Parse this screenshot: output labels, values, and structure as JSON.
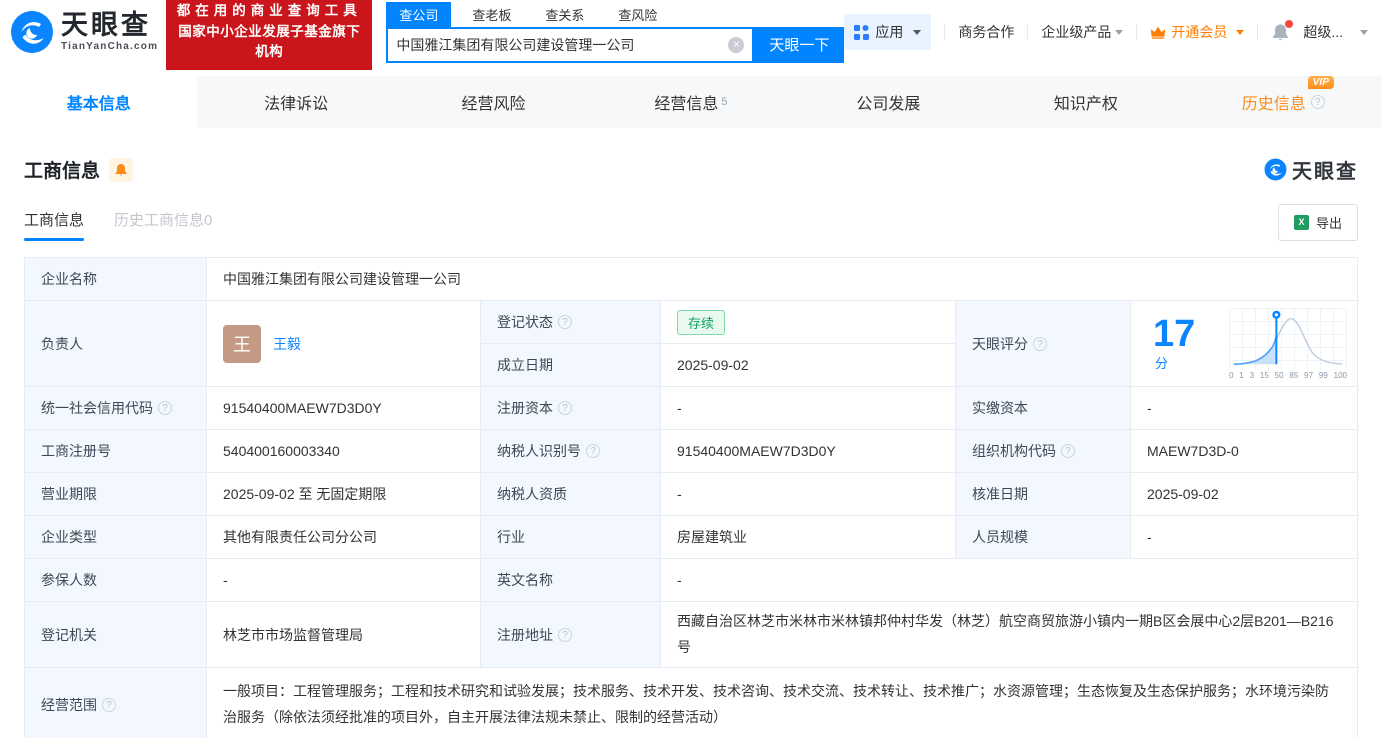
{
  "colors": {
    "brand_blue": "#0084ff",
    "orange": "#ff8c1a",
    "green_status": "#0ba360",
    "banner_red": "#c9151b"
  },
  "header": {
    "logo_title": "天眼查",
    "logo_domain": "TianYanCha.com",
    "banner_line1": "都在用的商业查询工具",
    "banner_line2": "国家中小企业发展子基金旗下机构",
    "search_tabs": [
      {
        "label": "查公司"
      },
      {
        "label": "查老板"
      },
      {
        "label": "查关系"
      },
      {
        "label": "查风险"
      }
    ],
    "search_value": "中国雅江集团有限公司建设管理一公司",
    "search_button": "天眼一下",
    "nav_apps": "应用",
    "nav_cooperation": "商务合作",
    "nav_enterprise": "企业级产品",
    "nav_vip": "开通会员",
    "nav_account": "超级..."
  },
  "nav_tabs": [
    {
      "label": "基本信息"
    },
    {
      "label": "法律诉讼"
    },
    {
      "label": "经营风险"
    },
    {
      "label": "经营信息",
      "count": "5"
    },
    {
      "label": "公司发展"
    },
    {
      "label": "知识产权"
    },
    {
      "label": "历史信息",
      "vip": "VIP"
    }
  ],
  "section": {
    "title": "工商信息",
    "subtab_active": "工商信息",
    "subtab_history": "历史工商信息",
    "subtab_history_count": "0",
    "export_label": "导出",
    "watermark_logo": "天眼查"
  },
  "table": {
    "company_name_label": "企业名称",
    "company_name": "中国雅江集团有限公司建设管理一公司",
    "legal_label": "负责人",
    "legal_avatar": "王",
    "legal_name": "王毅",
    "reg_status_label": "登记状态",
    "reg_status": "存续",
    "establish_label": "成立日期",
    "establish_date": "2025-09-02",
    "score_label": "天眼评分",
    "score_value": "17",
    "score_unit": "分",
    "credit_code_label": "统一社会信用代码",
    "credit_code": "91540400MAEW7D3D0Y",
    "reg_capital_label": "注册资本",
    "reg_capital": "-",
    "paid_capital_label": "实缴资本",
    "paid_capital": "-",
    "reg_no_label": "工商注册号",
    "reg_no": "540400160003340",
    "taxpayer_id_label": "纳税人识别号",
    "taxpayer_id": "91540400MAEW7D3D0Y",
    "org_code_label": "组织机构代码",
    "org_code": "MAEW7D3D-0",
    "term_label": "营业期限",
    "term": "2025-09-02 至 无固定期限",
    "taxpayer_qual_label": "纳税人资质",
    "taxpayer_qual": "-",
    "approval_label": "核准日期",
    "approval_date": "2025-09-02",
    "type_label": "企业类型",
    "type": "其他有限责任公司分公司",
    "industry_label": "行业",
    "industry": "房屋建筑业",
    "staff_label": "人员规模",
    "staff": "-",
    "insured_label": "参保人数",
    "insured": "-",
    "en_name_label": "英文名称",
    "en_name": "-",
    "authority_label": "登记机关",
    "authority": "林芝市市场监督管理局",
    "address_label": "注册地址",
    "address": "西藏自治区林芝市米林市米林镇邦仲村华发（林芝）航空商贸旅游小镇内一期B区会展中心2层B201—B216号",
    "scope_label": "经营范围",
    "scope": "一般项目：工程管理服务；工程和技术研究和试验发展；技术服务、技术开发、技术咨询、技术交流、技术转让、技术推广；水资源管理；生态恢复及生态保护服务；水环境污染防治服务（除依法须经批准的项目外，自主开展法律法规未禁止、限制的经营活动）"
  },
  "score_chart": {
    "axis": [
      "0",
      "1",
      "3",
      "15",
      "50",
      "85",
      "97",
      "99",
      "100"
    ]
  }
}
